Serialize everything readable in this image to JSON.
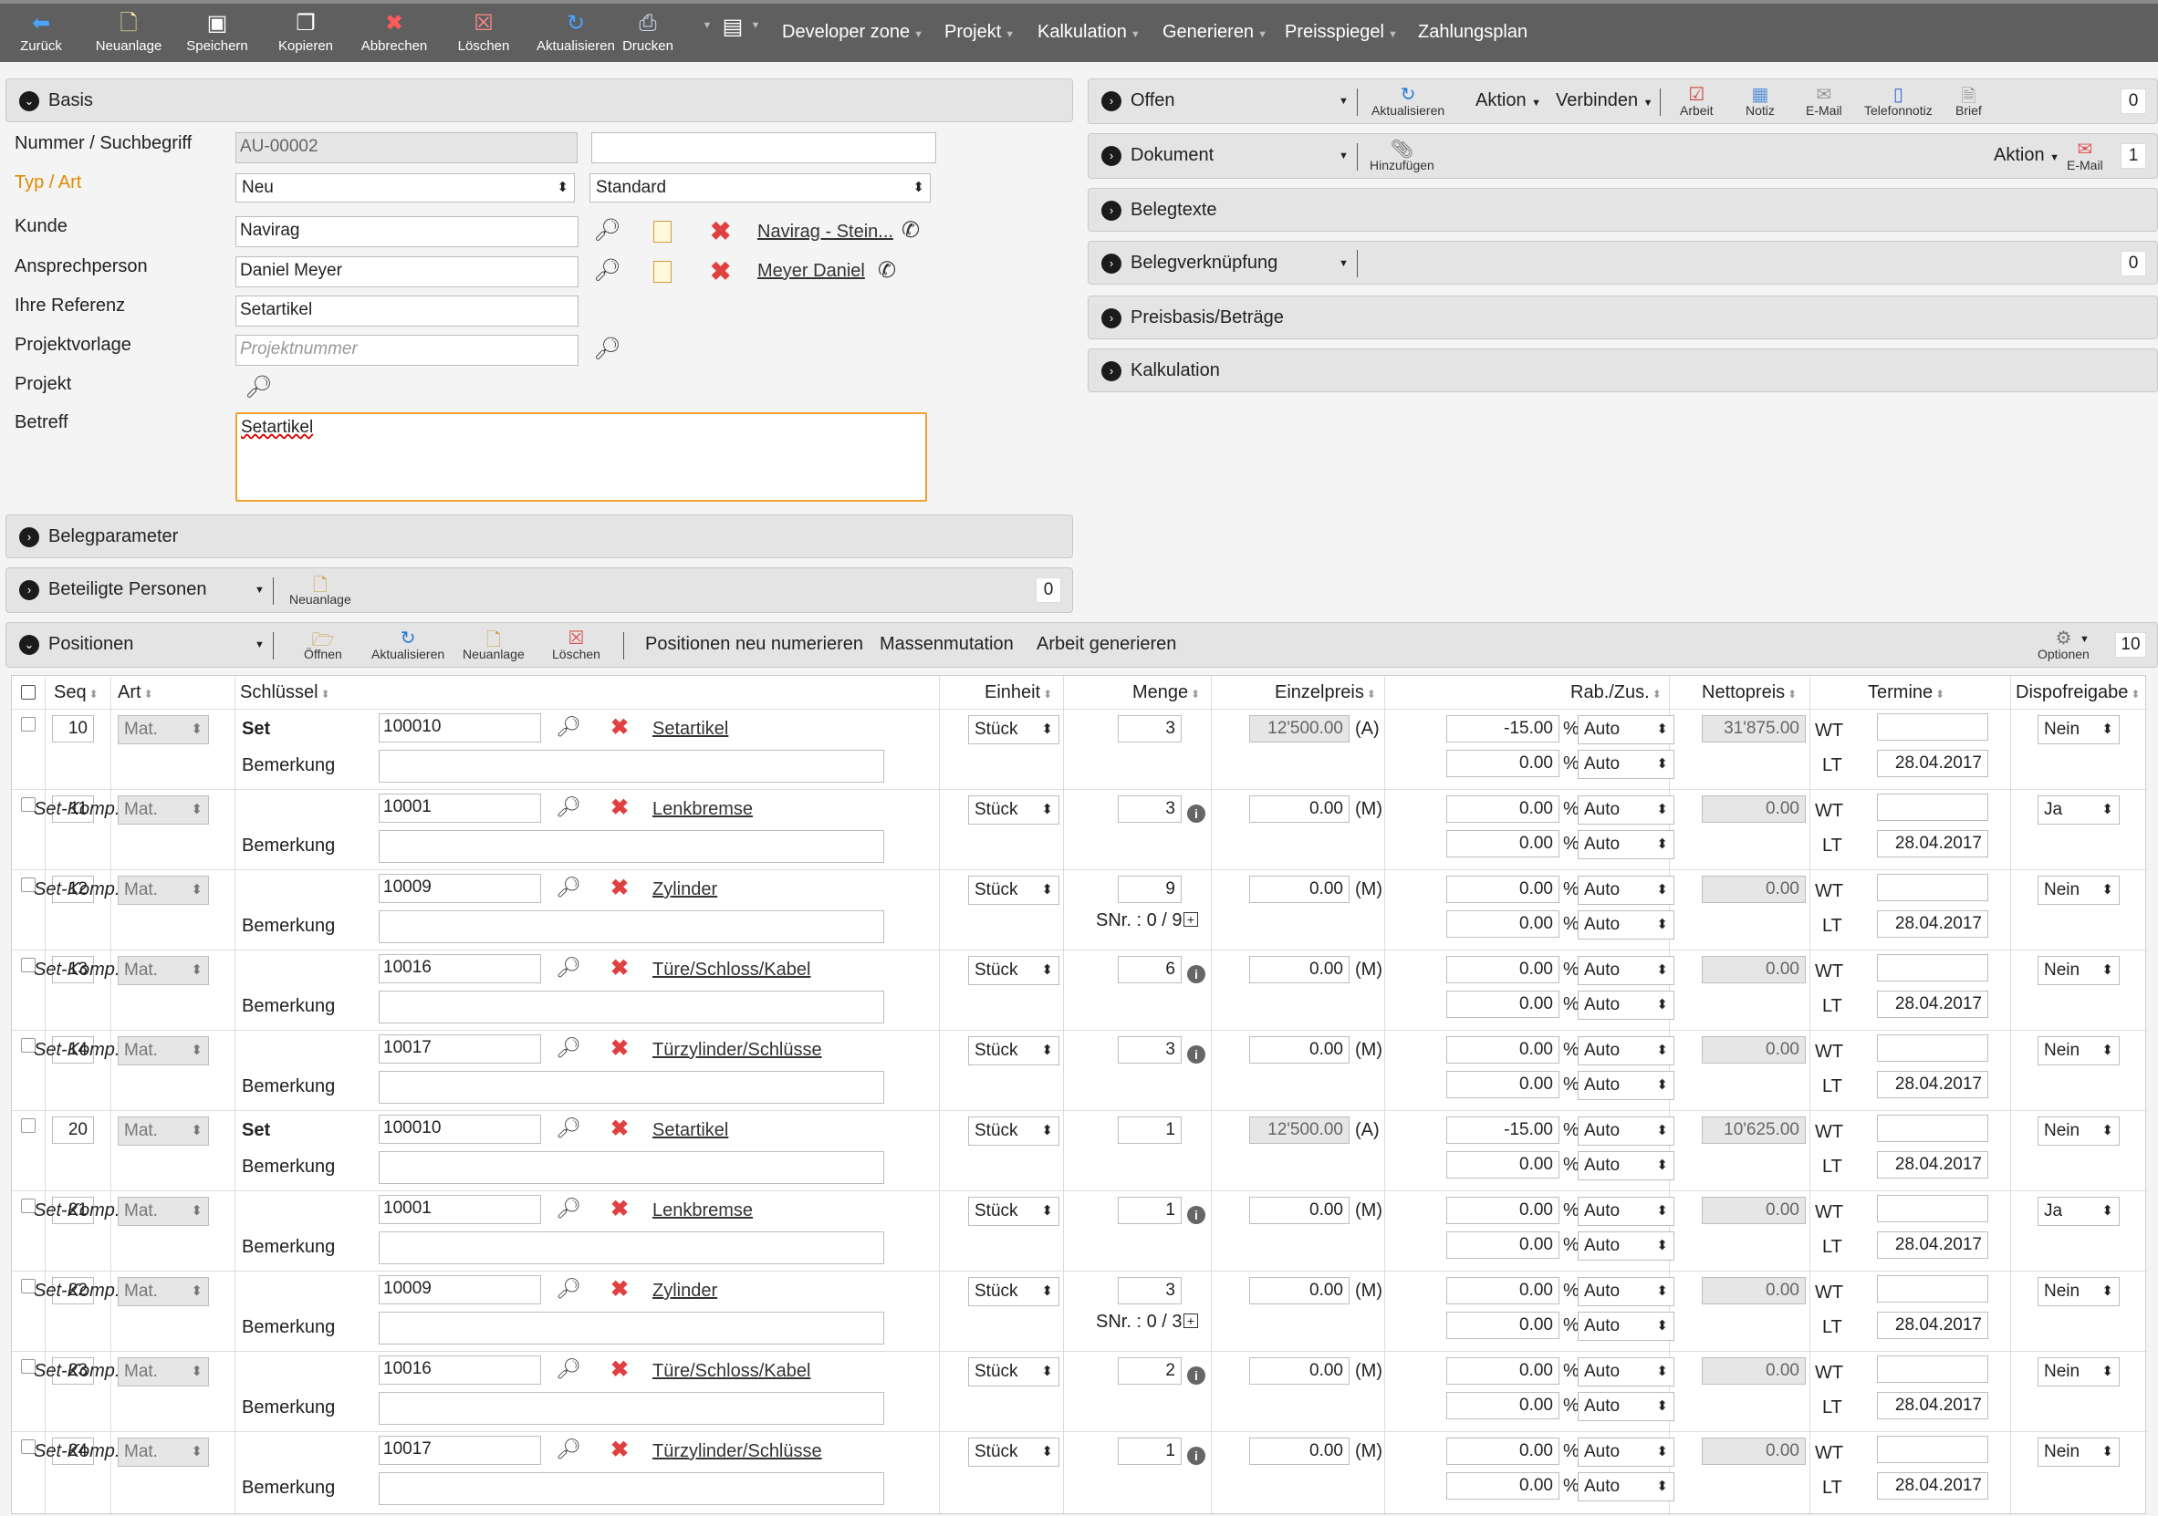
{
  "toolbar": {
    "back": "Zurück",
    "new": "Neuanlage",
    "save": "Speichern",
    "copy": "Kopieren",
    "cancel": "Abbrechen",
    "delete": "Löschen",
    "refresh": "Aktualisieren",
    "print": "Drucken"
  },
  "menu": [
    "Developer zone",
    "Projekt",
    "Kalkulation",
    "Generieren",
    "Preisspiegel",
    "Zahlungsplan"
  ],
  "basis": {
    "title": "Basis",
    "labels": {
      "nummer": "Nummer / Suchbegriff",
      "typ": "Typ / Art",
      "kunde": "Kunde",
      "ansprech": "Ansprechperson",
      "referenz": "Ihre Referenz",
      "projektvorlage": "Projektvorlage",
      "projekt": "Projekt",
      "betreff": "Betreff"
    },
    "nummer": "AU-00002",
    "typ": "Neu",
    "art": "Standard",
    "kunde": "Navirag",
    "kunde_link": "Navirag - Stein...",
    "ansprech": "Daniel Meyer",
    "ansprech_link": "Meyer Daniel ",
    "referenz": "Setartikel",
    "projektvorlage_ph": "Projektnummer",
    "betreff": "Setartikel"
  },
  "belegparameter": "Belegparameter",
  "beteiligte": {
    "title": "Beteiligte Personen",
    "new": "Neuanlage",
    "count": "0"
  },
  "right": {
    "offen": {
      "title": "Offen",
      "refresh": "Aktualisieren",
      "aktion": "Aktion",
      "verbinden": "Verbinden",
      "arbeit": "Arbeit",
      "notiz": "Notiz",
      "email": "E-Mail",
      "telefon": "Telefonnotiz",
      "brief": "Brief",
      "count": "0"
    },
    "dokument": {
      "title": "Dokument",
      "add": "Hinzufügen",
      "aktion": "Aktion",
      "email": "E-Mail",
      "count": "1"
    },
    "belegtexte": "Belegtexte",
    "belegverknuepfung": {
      "title": "Belegverknüpfung",
      "count": "0"
    },
    "preisbasis": "Preisbasis/Beträge",
    "kalkulation": "Kalkulation"
  },
  "positionen": {
    "title": "Positionen",
    "open": "Öffnen",
    "refresh": "Aktualisieren",
    "new": "Neuanlage",
    "delete": "Löschen",
    "renumber": "Positionen neu numerieren",
    "mass": "Massenmutation",
    "work": "Arbeit generieren",
    "options": "Optionen",
    "count": "10"
  },
  "columns": {
    "seq": "Seq",
    "art": "Art",
    "schluessel": "Schlüssel",
    "einheit": "Einheit",
    "menge": "Menge",
    "einzelpreis": "Einzelpreis",
    "rab": "Rab./Zus.",
    "netto": "Nettopreis",
    "termine": "Termine",
    "dispo": "Dispofreigabe"
  },
  "common": {
    "bemerkung": "Bemerkung",
    "mat": "Mat.",
    "unit": "Stück",
    "pct": "%",
    "auto": "Auto",
    "wt": "WT",
    "lt": "LT"
  },
  "rows": [
    {
      "seq": "10",
      "type": "Set",
      "key": "100010",
      "name": "Setartikel",
      "qty": "3",
      "snr": "",
      "price": "12'500.00",
      "pflag": "(A)",
      "rab1": "-15.00",
      "rab2": "0.00",
      "net": "31'875.00",
      "date": "28.04.2017",
      "dispo": "Nein"
    },
    {
      "seq": "11",
      "type": "Set-Komp.",
      "key": "10001",
      "name": "Lenkbremse",
      "qty": "3",
      "snr": "",
      "price": "0.00",
      "pflag": "(M)",
      "rab1": "0.00",
      "rab2": "0.00",
      "net": "0.00",
      "date": "28.04.2017",
      "dispo": "Ja"
    },
    {
      "seq": "12",
      "type": "Set-Komp.",
      "key": "10009",
      "name": "Zylinder",
      "qty": "9",
      "snr": "SNr. : 0 / 9",
      "price": "0.00",
      "pflag": "(M)",
      "rab1": "0.00",
      "rab2": "0.00",
      "net": "0.00",
      "date": "28.04.2017",
      "dispo": "Nein"
    },
    {
      "seq": "13",
      "type": "Set-Komp.",
      "key": "10016",
      "name": "Türe/Schloss/Kabel",
      "qty": "6",
      "snr": "",
      "price": "0.00",
      "pflag": "(M)",
      "rab1": "0.00",
      "rab2": "0.00",
      "net": "0.00",
      "date": "28.04.2017",
      "dispo": "Nein"
    },
    {
      "seq": "14",
      "type": "Set-Komp.",
      "key": "10017",
      "name": "Türzylinder/Schlüsse",
      "qty": "3",
      "snr": "",
      "price": "0.00",
      "pflag": "(M)",
      "rab1": "0.00",
      "rab2": "0.00",
      "net": "0.00",
      "date": "28.04.2017",
      "dispo": "Nein"
    },
    {
      "seq": "20",
      "type": "Set",
      "key": "100010",
      "name": "Setartikel",
      "qty": "1",
      "snr": "",
      "price": "12'500.00",
      "pflag": "(A)",
      "rab1": "-15.00",
      "rab2": "0.00",
      "net": "10'625.00",
      "date": "28.04.2017",
      "dispo": "Nein"
    },
    {
      "seq": "21",
      "type": "Set-Komp.",
      "key": "10001",
      "name": "Lenkbremse",
      "qty": "1",
      "snr": "",
      "price": "0.00",
      "pflag": "(M)",
      "rab1": "0.00",
      "rab2": "0.00",
      "net": "0.00",
      "date": "28.04.2017",
      "dispo": "Ja"
    },
    {
      "seq": "22",
      "type": "Set-Komp.",
      "key": "10009",
      "name": "Zylinder",
      "qty": "3",
      "snr": "SNr. : 0 / 3",
      "price": "0.00",
      "pflag": "(M)",
      "rab1": "0.00",
      "rab2": "0.00",
      "net": "0.00",
      "date": "28.04.2017",
      "dispo": "Nein"
    },
    {
      "seq": "23",
      "type": "Set-Komp.",
      "key": "10016",
      "name": "Türe/Schloss/Kabel",
      "qty": "2",
      "snr": "",
      "price": "0.00",
      "pflag": "(M)",
      "rab1": "0.00",
      "rab2": "0.00",
      "net": "0.00",
      "date": "28.04.2017",
      "dispo": "Nein"
    },
    {
      "seq": "24",
      "type": "Set-Komp.",
      "key": "10017",
      "name": "Türzylinder/Schlüsse",
      "qty": "1",
      "snr": "",
      "price": "0.00",
      "pflag": "(M)",
      "rab1": "0.00",
      "rab2": "0.00",
      "net": "0.00",
      "date": "28.04.2017",
      "dispo": "Nein"
    }
  ]
}
